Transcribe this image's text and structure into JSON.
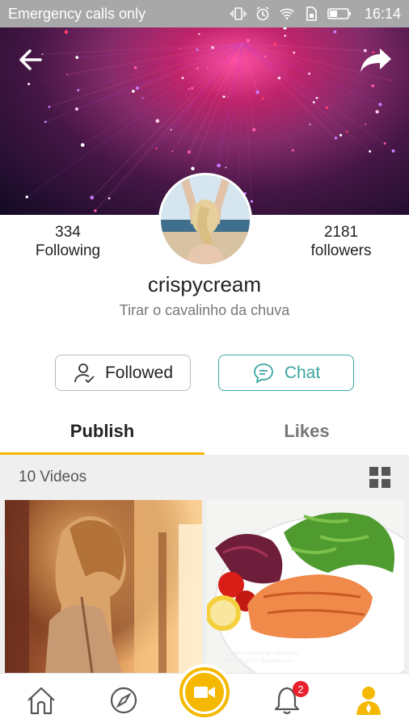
{
  "status_bar": {
    "carrier": "Emergency calls only",
    "time": "16:14"
  },
  "profile": {
    "following_count": "334",
    "following_label": "Following",
    "followers_count": "2181",
    "followers_label": "followers",
    "username": "crispycream",
    "bio": "Tirar o cavalinho da chuva"
  },
  "actions": {
    "followed_label": "Followed",
    "chat_label": "Chat"
  },
  "tabs": [
    {
      "label": "Publish",
      "active": true
    },
    {
      "label": "Likes",
      "active": false
    }
  ],
  "videos": {
    "count_label": "10 Videos",
    "thumbnail_watermark": "Linger's kitchen all copyrights\nhttp://linger27.diandian.com"
  },
  "bottom_nav": {
    "notification_badge": "2",
    "accent_color": "#f4b800"
  },
  "colors": {
    "chat_teal": "#3aa6a0",
    "tab_underline": "#f7b500",
    "badge_red": "#e8222d"
  },
  "icons": {
    "back": "arrow-left-icon",
    "share": "share-icon",
    "followed": "user-check-icon",
    "chat": "chat-bubble-icon",
    "grid": "grid-view-icon",
    "home": "home-icon",
    "discover": "compass-icon",
    "record": "video-camera-icon",
    "notifications": "bell-icon",
    "me": "profile-icon"
  }
}
